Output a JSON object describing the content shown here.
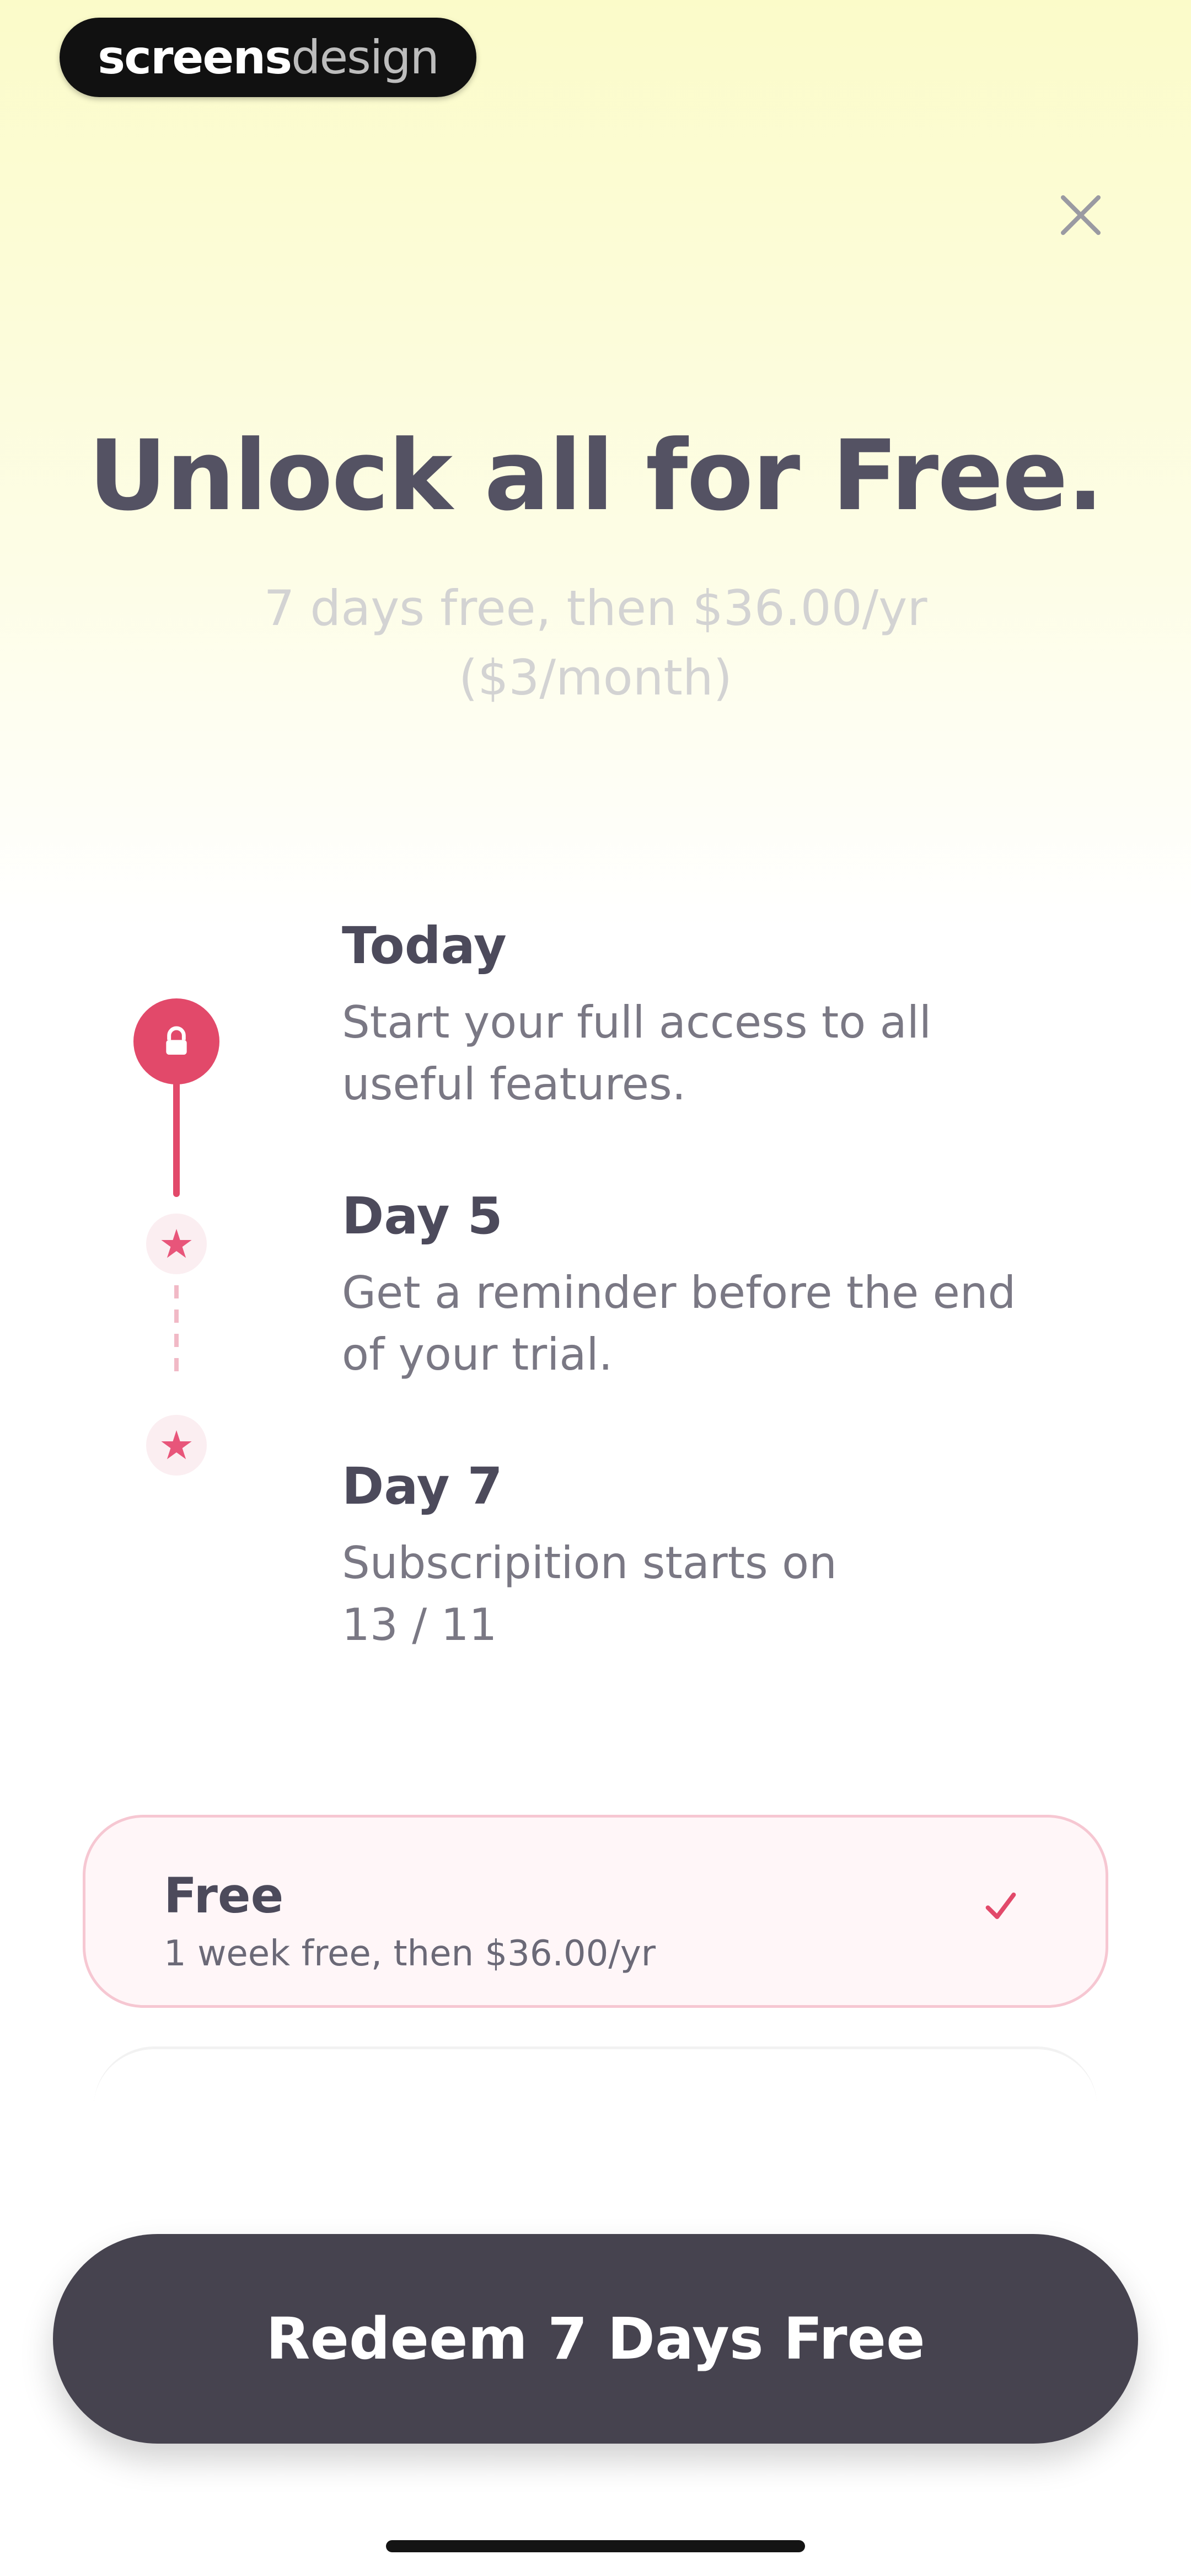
{
  "brand": {
    "bold": "screens",
    "light": "design"
  },
  "header": {
    "close_icon": "close-icon"
  },
  "hero": {
    "title": "Unlock all for Free.",
    "subtitle_line1": "7 days free, then $36.00/yr",
    "subtitle_line2": "($3/month)"
  },
  "timeline": {
    "steps": [
      {
        "title": "Today",
        "description_line1": "Start your full access to all",
        "description_line2": "useful features.",
        "icon": "lock-icon"
      },
      {
        "title": "Day 5",
        "description_line1": "Get a reminder before the end",
        "description_line2": "of your trial.",
        "icon": "star-icon"
      },
      {
        "title": "Day 7",
        "description_line1": "Subscripition starts on",
        "description_line2": "13 / 11",
        "icon": "star-icon"
      }
    ]
  },
  "plans": [
    {
      "title": "Free",
      "subtitle": "1 week free, then $36.00/yr",
      "selected": true,
      "check_icon": "check-icon"
    }
  ],
  "cta": {
    "label": "Redeem 7 Days Free"
  },
  "colors": {
    "accent": "#e2496a",
    "button_bg": "#46434f",
    "title_text": "#545263"
  }
}
